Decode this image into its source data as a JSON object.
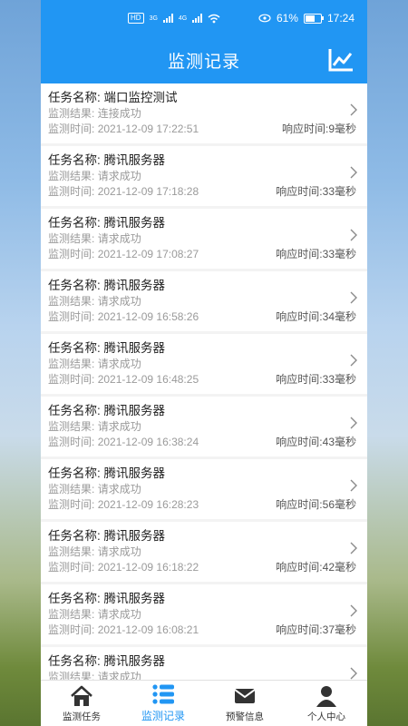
{
  "status_bar": {
    "left_chips": [
      "HD",
      "HD"
    ],
    "net1": "3G",
    "net2": "4G",
    "battery_text": "61%",
    "battery_level": 0.61,
    "time": "17:24"
  },
  "app_bar": {
    "title": "监测记录",
    "chart_icon": "line-chart-icon"
  },
  "labels": {
    "task_name": "任务名称:",
    "result": "监测结果:",
    "time": "监测时间:",
    "response": "响应时间:"
  },
  "records": [
    {
      "name": "端口监控测试",
      "result": "连接成功",
      "time": "2021-12-09 17:22:51",
      "response": "9毫秒"
    },
    {
      "name": "腾讯服务器",
      "result": "请求成功",
      "time": "2021-12-09 17:18:28",
      "response": "33毫秒"
    },
    {
      "name": "腾讯服务器",
      "result": "请求成功",
      "time": "2021-12-09 17:08:27",
      "response": "33毫秒"
    },
    {
      "name": "腾讯服务器",
      "result": "请求成功",
      "time": "2021-12-09 16:58:26",
      "response": "34毫秒"
    },
    {
      "name": "腾讯服务器",
      "result": "请求成功",
      "time": "2021-12-09 16:48:25",
      "response": "33毫秒"
    },
    {
      "name": "腾讯服务器",
      "result": "请求成功",
      "time": "2021-12-09 16:38:24",
      "response": "43毫秒"
    },
    {
      "name": "腾讯服务器",
      "result": "请求成功",
      "time": "2021-12-09 16:28:23",
      "response": "56毫秒"
    },
    {
      "name": "腾讯服务器",
      "result": "请求成功",
      "time": "2021-12-09 16:18:22",
      "response": "42毫秒"
    },
    {
      "name": "腾讯服务器",
      "result": "请求成功",
      "time": "2021-12-09 16:08:21",
      "response": "37毫秒"
    },
    {
      "name": "腾讯服务器",
      "result": "请求成功",
      "time": "",
      "response": ""
    }
  ],
  "bottom_nav": [
    {
      "label": "监测任务",
      "icon": "home-icon",
      "active": false
    },
    {
      "label": "监测记录",
      "icon": "list-icon",
      "active": true
    },
    {
      "label": "预警信息",
      "icon": "mail-icon",
      "active": false
    },
    {
      "label": "个人中心",
      "icon": "user-icon",
      "active": false
    }
  ],
  "colors": {
    "primary": "#2196f3",
    "text_muted": "#9a9a9a"
  }
}
